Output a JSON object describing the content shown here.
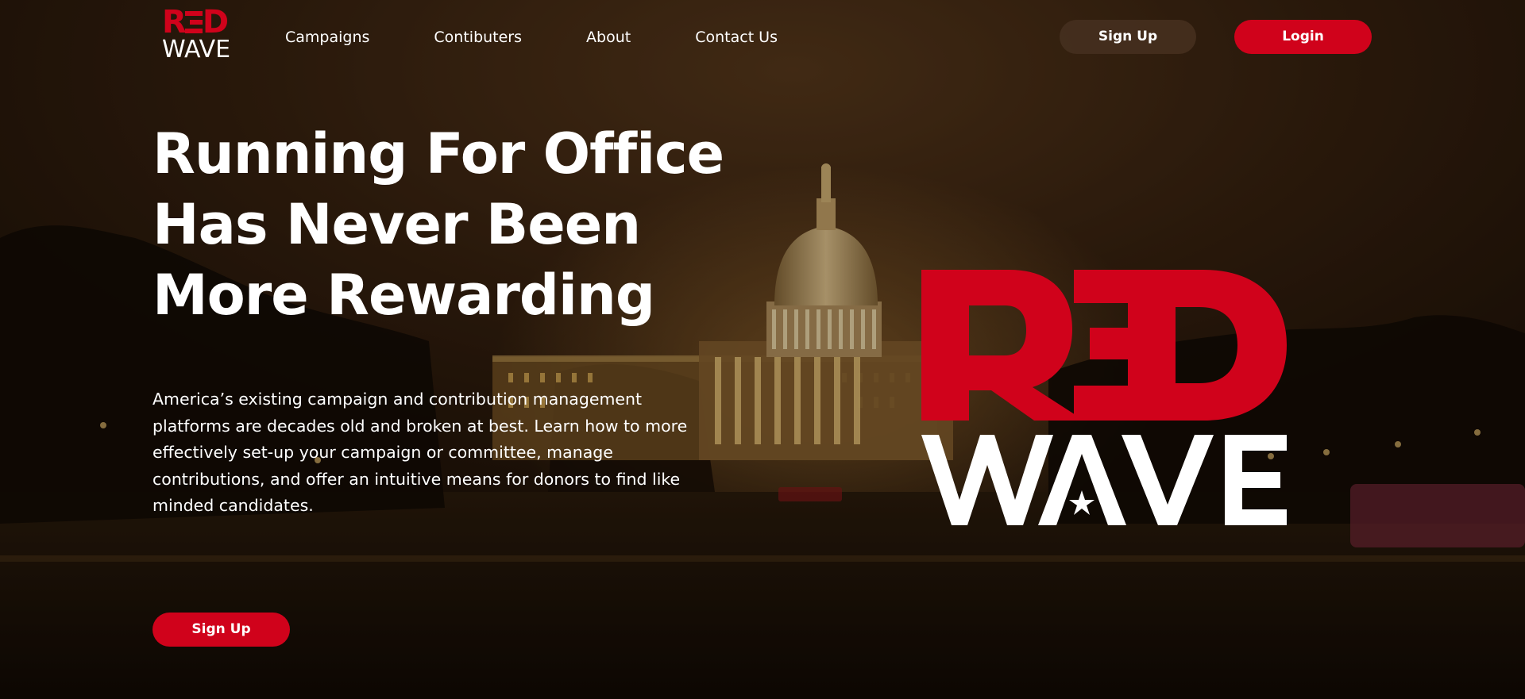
{
  "brand": {
    "logo_top": "RED",
    "logo_bottom": "WAVE",
    "colors": {
      "accent": "#d0021b",
      "text": "#ffffff",
      "dark_button": "#463020"
    }
  },
  "nav": {
    "items": [
      {
        "label": "Campaigns"
      },
      {
        "label": "Contibuters"
      },
      {
        "label": "About"
      },
      {
        "label": "Contact Us"
      }
    ]
  },
  "header": {
    "signup_label": "Sign Up",
    "login_label": "Login"
  },
  "hero": {
    "title_lines": [
      "Running For Office",
      "Has Never Been",
      "More Rewarding"
    ],
    "description_lines": [
      "America’s existing campaign and contribution management",
      "platforms are decades old and broken at best. Learn how to more",
      "effectively set-up your campaign or committee, manage",
      "contributions, and offer an intuitive means for donors to find like",
      "minded candidates."
    ],
    "signup_label": "Sign Up"
  },
  "background": {
    "icon": "capitol-building-night-scene"
  }
}
